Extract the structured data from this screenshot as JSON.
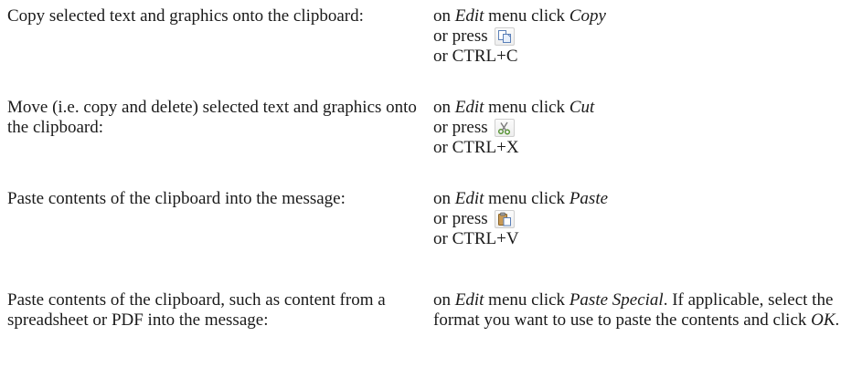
{
  "rows": [
    {
      "description": "Copy selected text and graphics onto the clipboard:",
      "menu_prefix": "on ",
      "menu_name": "Edit",
      "menu_mid": " menu click ",
      "command": "Copy",
      "press_label": "or press",
      "toolbar_icon": "copy-icon",
      "shortcut": "or CTRL+C"
    },
    {
      "description": "Move (i.e. copy and delete) selected text and graphics onto the clipboard:",
      "menu_prefix": "on ",
      "menu_name": "Edit",
      "menu_mid": " menu click ",
      "command": "Cut",
      "press_label": "or press",
      "toolbar_icon": "scissors-icon",
      "shortcut": "or CTRL+X"
    },
    {
      "description": "Paste contents of the clipboard into the message:",
      "menu_prefix": "on ",
      "menu_name": "Edit",
      "menu_mid": " menu click ",
      "command": "Paste",
      "press_label": "or press",
      "toolbar_icon": "clipboard-paste-icon",
      "shortcut": "or CTRL+V"
    },
    {
      "description": "Paste contents of the clipboard, such as content from a spreadsheet or PDF into the message:",
      "menu_prefix": "on ",
      "menu_name": "Edit",
      "menu_mid": " menu click ",
      "command": "Paste Special",
      "after_command": ". If applicable, select the format you want to use to paste the contents and click ",
      "final_button": "OK",
      "final_punct": "."
    }
  ]
}
